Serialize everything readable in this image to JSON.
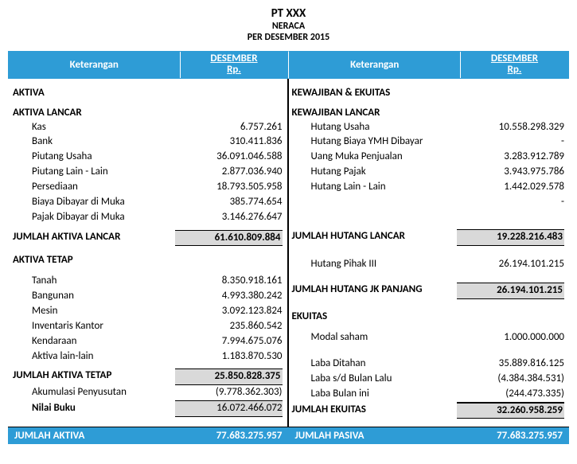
{
  "title": {
    "company": "PT XXX",
    "report": "NERACA",
    "period": "PER DESEMBER 2015"
  },
  "headers": {
    "keterangan": "Keterangan",
    "periode": "DESEMBER",
    "currency": "Rp."
  },
  "left": {
    "section": "AKTIVA",
    "lancar": {
      "heading": "AKTIVA LANCAR",
      "items": [
        {
          "label": "Kas",
          "value": "6.757.261"
        },
        {
          "label": "Bank",
          "value": "310.411.836"
        },
        {
          "label": "Piutang Usaha",
          "value": "36.091.046.588"
        },
        {
          "label": "Piutang Lain - Lain",
          "value": "2.877.036.940"
        },
        {
          "label": "Persediaan",
          "value": "18.793.505.958"
        },
        {
          "label": "Biaya Dibayar di Muka",
          "value": "385.774.654"
        },
        {
          "label": "Pajak Dibayar di Muka",
          "value": "3.146.276.647"
        }
      ],
      "total_label": "JUMLAH AKTIVA LANCAR",
      "total_value": "61.610.809.884"
    },
    "tetap": {
      "heading": "AKTIVA TETAP",
      "items": [
        {
          "label": "Tanah",
          "value": "8.350.918.161"
        },
        {
          "label": "Bangunan",
          "value": "4.993.380.242"
        },
        {
          "label": "Mesin",
          "value": "3.092.123.824"
        },
        {
          "label": "Inventaris Kantor",
          "value": "235.860.542"
        },
        {
          "label": "Kendaraan",
          "value": "7.994.675.076"
        },
        {
          "label": "Aktiva lain-lain",
          "value": "1.183.870.530"
        }
      ],
      "total_label": "JUMLAH AKTIVA TETAP",
      "total_value": "25.850.828.375",
      "akum_label": "Akumulasi Penyusutan",
      "akum_value": "(9.778.362.303)",
      "nilai_label": "Nilai Buku",
      "nilai_value": "16.072.466.072"
    }
  },
  "right": {
    "section": "KEWAJIBAN & EKUITAS",
    "lancar": {
      "heading": "KEWAJIBAN LANCAR",
      "items": [
        {
          "label": "Hutang Usaha",
          "value": "10.558.298.329"
        },
        {
          "label": "Hutang Biaya YMH Dibayar",
          "value": "-"
        },
        {
          "label": "Uang Muka Penjualan",
          "value": "3.283.912.789"
        },
        {
          "label": "Hutang Pajak",
          "value": "3.943.975.786"
        },
        {
          "label": "Hutang Lain - Lain",
          "value": "1.442.029.578"
        },
        {
          "label": "",
          "value": "-"
        }
      ],
      "total_label": "JUMLAH HUTANG LANCAR",
      "total_value": "19.228.216.483"
    },
    "panjang": {
      "pihak3_label": "Hutang Pihak III",
      "pihak3_value": "26.194.101.215",
      "total_label": "JUMLAH HUTANG JK PANJANG",
      "total_value": "26.194.101.215"
    },
    "ekuitas": {
      "heading": "EKUITAS",
      "modal_label": "Modal saham",
      "modal_value": "1.000.000.000",
      "items": [
        {
          "label": "Laba Ditahan",
          "value": "35.889.816.125"
        },
        {
          "label": "Laba s/d Bulan Lalu",
          "value": "(4.384.384.531)"
        },
        {
          "label": "Laba Bulan ini",
          "value": "(244.473.335)"
        }
      ],
      "total_label": "JUMLAH EKUITAS",
      "total_value": "32.260.958.259"
    }
  },
  "grand": {
    "aktiva_label": "JUMLAH AKTIVA",
    "aktiva_value": "77.683.275.957",
    "pasiva_label": "JUMLAH PASIVA",
    "pasiva_value": "77.683.275.957"
  }
}
